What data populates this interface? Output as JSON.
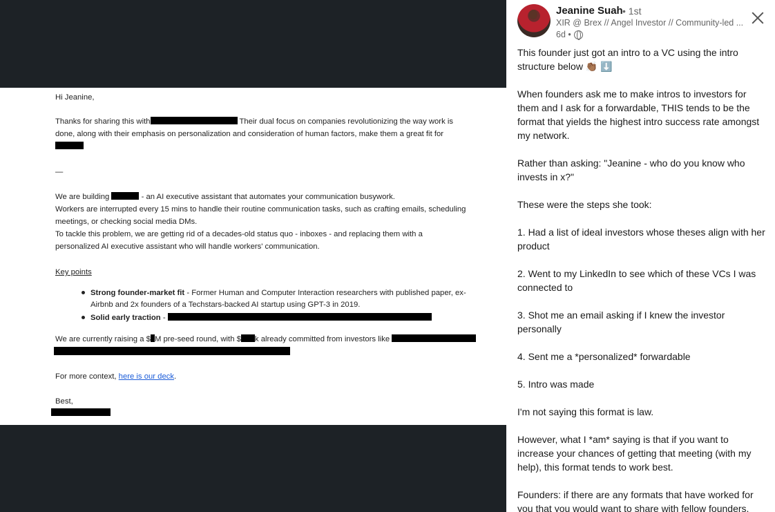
{
  "email": {
    "greeting": "Hi Jeanine,",
    "intro_prefix": "Thanks for sharing this with",
    "intro_suffix": " Their dual focus on companies revolutionizing the way work is",
    "intro_line2": "done, along with their emphasis on personalization and consideration of human factors, make them a great fit for",
    "divider": "—",
    "building_prefix": "We are building ",
    "building_suffix": " - an AI executive assistant that automates your communication busywork.",
    "workers_line1": "Workers are interrupted every 15 mins to handle their routine communication tasks, such as crafting emails, scheduling",
    "workers_line2": "meetings, or checking social media DMs.",
    "tackle_line1": "To tackle this problem, we are getting rid of a decades-old status quo - inboxes - and replacing them with a",
    "tackle_line2": "personalized AI executive assistant who will handle workers' communication.",
    "key_points_heading": "Key points",
    "bullet1_bold": "Strong founder-market fit",
    "bullet1_text": " - Former Human and Computer Interaction researchers with published paper, ex-",
    "bullet1_line2": "Airbnb and 2x founders of a Techstars-backed AI startup using GPT-3 in 2019.",
    "bullet2_bold": "Solid early traction",
    "bullet2_text": " - ",
    "raising_a": "We are currently raising a $",
    "raising_b": "M pre-seed round, with $",
    "raising_c": "k already committed from investors like ",
    "context_prefix": "For more context, ",
    "context_link": "here is our deck",
    "context_suffix": ".",
    "signoff": "Best,"
  },
  "post": {
    "author": "Jeanine Suah",
    "degree": "• 1st",
    "headline": "XIR @ Brex // Angel Investor // Community-led ...",
    "time": "6d •",
    "paragraphs": [
      "This founder just got an intro to a VC using the intro structure below 👏🏾 ⬇️",
      "When founders ask me to make intros to investors for them and I ask for a forwardable, THIS tends to be the format that yields the highest intro success rate amongst my network.",
      "Rather than asking: \"Jeanine - who do you know who invests in x?\"",
      "These were the steps she took:",
      "1. Had a list of ideal investors whose theses align with her product",
      "2. Went to my LinkedIn to see which of these VCs I was connected to",
      "3. Shot me an email asking if I knew the investor personally",
      "4. Sent me a *personalized* forwardable",
      "5. Intro was made",
      "I'm not saying this format is law.",
      "However, what I *am* saying is that if you want to increase your chances of getting that meeting (with my help), this format tends to work best.",
      "Founders: if there are any formats that have worked for you that you would want to share with fellow founders,"
    ]
  }
}
